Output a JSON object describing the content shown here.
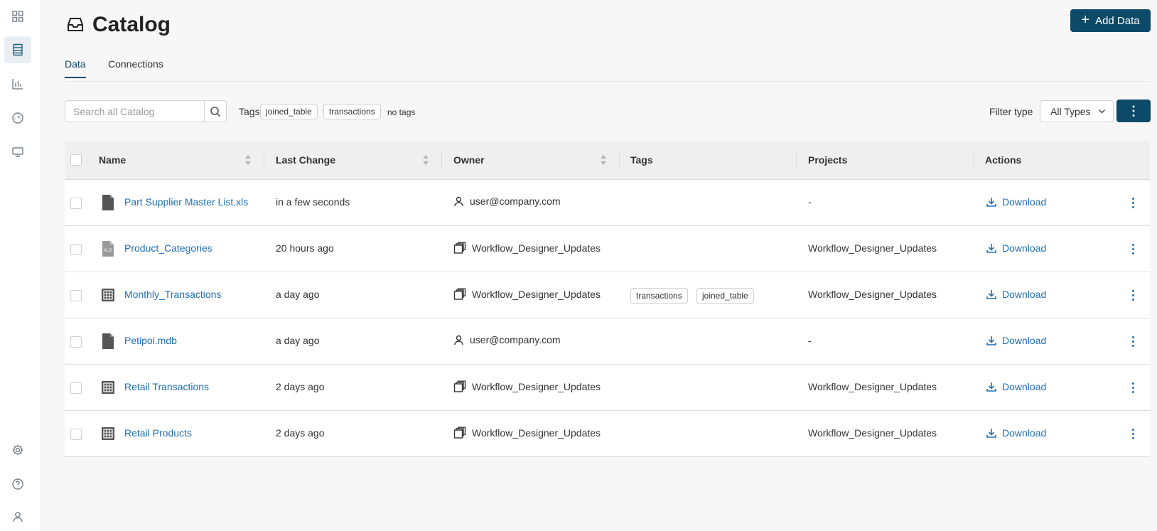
{
  "sidebar": {
    "items": [
      {
        "icon": "grid-icon"
      },
      {
        "icon": "catalog-icon",
        "active": true
      },
      {
        "icon": "chart-icon"
      },
      {
        "icon": "dashboard-icon"
      },
      {
        "icon": "monitor-icon"
      }
    ],
    "bottom": [
      {
        "icon": "gear-icon"
      },
      {
        "icon": "help-icon"
      },
      {
        "icon": "user-icon"
      }
    ]
  },
  "header": {
    "title": "Catalog",
    "add_button_label": "Add Data",
    "add_button_color": "#0d4a68"
  },
  "tabs": [
    {
      "label": "Data",
      "active": true
    },
    {
      "label": "Connections",
      "active": false
    }
  ],
  "toolbar": {
    "search_placeholder": "Search all Catalog",
    "tags_label": "Tags",
    "tag_chips": [
      "joined_table",
      "transactions"
    ],
    "no_tags_label": "no tags",
    "filter_label": "Filter type",
    "filter_value": "All Types"
  },
  "table": {
    "columns": [
      "Name",
      "Last Change",
      "Owner",
      "Tags",
      "Projects",
      "Actions"
    ],
    "rows": [
      {
        "name": "Part Supplier Master List.xls",
        "file_icon": "document-icon",
        "last_change": "in a few seconds",
        "owner": "user@company.com",
        "owner_type": "user",
        "tags": [],
        "project": "-",
        "action": "Download"
      },
      {
        "name": "Product_Categories",
        "file_icon": "xls-icon",
        "last_change": "20 hours ago",
        "owner": "Workflow_Designer_Updates",
        "owner_type": "project",
        "tags": [],
        "project": "Workflow_Designer_Updates",
        "action": "Download"
      },
      {
        "name": "Monthly_Transactions",
        "file_icon": "table-icon",
        "last_change": "a day ago",
        "owner": "Workflow_Designer_Updates",
        "owner_type": "project",
        "tags": [
          "transactions",
          "joined_table"
        ],
        "project": "Workflow_Designer_Updates",
        "action": "Download"
      },
      {
        "name": "Petipoi.mdb",
        "file_icon": "document-icon",
        "last_change": "a day ago",
        "owner": "user@company.com",
        "owner_type": "user",
        "tags": [],
        "project": "-",
        "action": "Download"
      },
      {
        "name": "Retail Transactions",
        "file_icon": "table-icon",
        "last_change": "2 days ago",
        "owner": "Workflow_Designer_Updates",
        "owner_type": "project",
        "tags": [],
        "project": "Workflow_Designer_Updates",
        "action": "Download"
      },
      {
        "name": "Retail Products",
        "file_icon": "table-icon",
        "last_change": "2 days ago",
        "owner": "Workflow_Designer_Updates",
        "owner_type": "project",
        "tags": [],
        "project": "Workflow_Designer_Updates",
        "action": "Download"
      }
    ]
  },
  "colors": {
    "accent": "#0d4a68",
    "link": "#1f6fb2"
  }
}
